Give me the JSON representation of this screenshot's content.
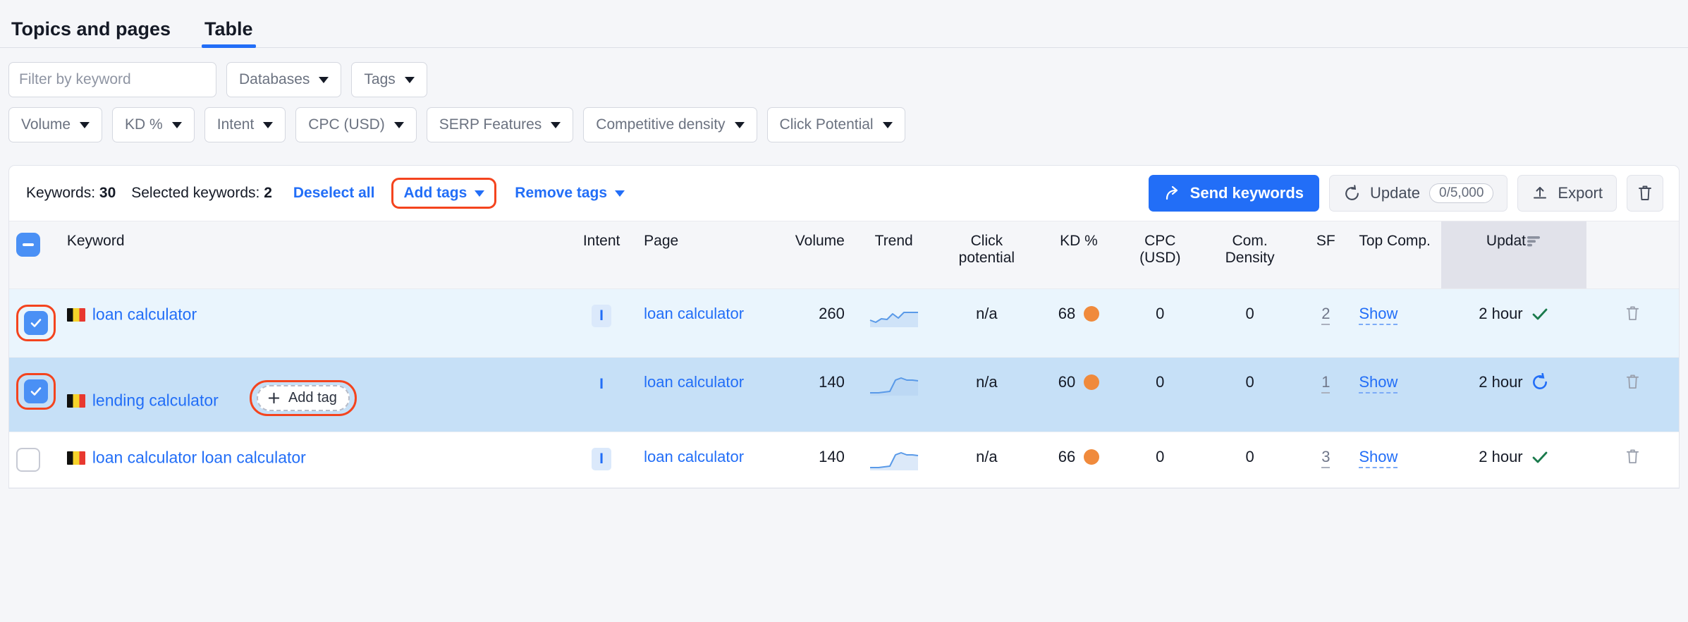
{
  "tabs": [
    {
      "label": "Topics and pages",
      "active": false
    },
    {
      "label": "Table",
      "active": true
    }
  ],
  "search": {
    "placeholder": "Filter by keyword",
    "value": "",
    "icon": "search-icon"
  },
  "filters": [
    {
      "label": "Databases"
    },
    {
      "label": "Tags"
    },
    {
      "label": "Volume"
    },
    {
      "label": "KD %"
    },
    {
      "label": "Intent"
    },
    {
      "label": "CPC (USD)"
    },
    {
      "label": "SERP Features"
    },
    {
      "label": "Competitive density"
    },
    {
      "label": "Click Potential"
    }
  ],
  "toolbar": {
    "keywords_label": "Keywords:",
    "keywords_count": "30",
    "selected_label": "Selected keywords:",
    "selected_count": "2",
    "deselect_all": "Deselect all",
    "add_tags": "Add tags",
    "remove_tags": "Remove tags",
    "send_keywords": "Send keywords",
    "update": "Update",
    "update_quota": "0/5,000",
    "export": "Export",
    "delete_icon": "trash-icon",
    "highlight_color": "#f4441e"
  },
  "table": {
    "columns": [
      {
        "key": "check",
        "label": ""
      },
      {
        "key": "kw",
        "label": "Keyword"
      },
      {
        "key": "intent",
        "label": "Intent"
      },
      {
        "key": "page",
        "label": "Page"
      },
      {
        "key": "vol",
        "label": "Volume"
      },
      {
        "key": "trend",
        "label": "Trend"
      },
      {
        "key": "click",
        "label": "Click potential"
      },
      {
        "key": "kd",
        "label": "KD %"
      },
      {
        "key": "cpc",
        "label": "CPC (USD)"
      },
      {
        "key": "com",
        "label": "Com. Density"
      },
      {
        "key": "sf",
        "label": "SF"
      },
      {
        "key": "top",
        "label": "Top Comp."
      },
      {
        "key": "upd",
        "label": "Updat"
      },
      {
        "key": "del",
        "label": ""
      }
    ],
    "header_checkbox_state": "indeterminate",
    "sorted_column": "upd",
    "rows": [
      {
        "selected": true,
        "highlight_checkbox": true,
        "flag": "belgium-flag",
        "keyword": "loan calculator",
        "intent": "I",
        "intent_filled": true,
        "page": "loan calculator",
        "volume": "260",
        "trend": "sparkline-flat-spike",
        "click_potential": "n/a",
        "kd": "68",
        "cpc": "0",
        "com_density": "0",
        "sf": "2",
        "top_comp": "Show",
        "updated": "2 hour",
        "update_status": "check",
        "add_tag": null
      },
      {
        "selected": true,
        "highlight_checkbox": true,
        "flag": "belgium-flag",
        "keyword": "lending calculator",
        "intent": "I",
        "intent_filled": false,
        "page": "loan calculator",
        "volume": "140",
        "trend": "sparkline-rise",
        "click_potential": "n/a",
        "kd": "60",
        "cpc": "0",
        "com_density": "0",
        "sf": "1",
        "top_comp": "Show",
        "updated": "2 hour",
        "update_status": "refresh",
        "add_tag": "Add tag"
      },
      {
        "selected": false,
        "highlight_checkbox": false,
        "flag": "belgium-flag",
        "keyword": "loan calculator loan calculator",
        "intent": "I",
        "intent_filled": true,
        "page": "loan calculator",
        "volume": "140",
        "trend": "sparkline-rise",
        "click_potential": "n/a",
        "kd": "66",
        "cpc": "0",
        "com_density": "0",
        "sf": "3",
        "top_comp": "Show",
        "updated": "2 hour",
        "update_status": "check",
        "add_tag": null
      }
    ]
  },
  "colors": {
    "accent": "#226ef7",
    "highlight": "#f4441e",
    "kd_dot": "#f08a3c",
    "check_green": "#1a7a4c",
    "row_sel_light": "#eaf5fd",
    "row_sel_dark": "#c6e0f7"
  }
}
